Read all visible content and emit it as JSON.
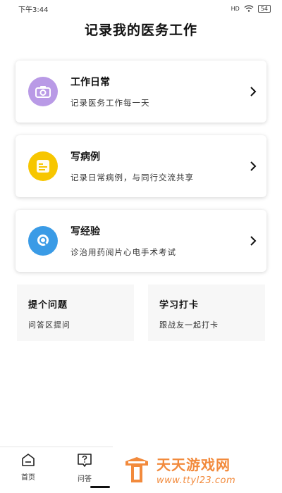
{
  "status_bar": {
    "time": "下午3:44",
    "signal": "HD",
    "battery": "54"
  },
  "page": {
    "title": "记录我的医务工作"
  },
  "cards": [
    {
      "title": "工作日常",
      "subtitle": "记录医务工作每一天",
      "icon": "camera-icon",
      "color": "#b99ae6"
    },
    {
      "title": "写病例",
      "subtitle": "记录日常病例，与同行交流共享",
      "icon": "document-icon",
      "color": "#f7c600"
    },
    {
      "title": "写经验",
      "subtitle": "诊治用药阅片心电手术考试",
      "icon": "chat-icon",
      "color": "#3a9be6"
    }
  ],
  "mini_cards": [
    {
      "title": "提个问题",
      "subtitle": "问答区提问"
    },
    {
      "title": "学习打卡",
      "subtitle": "跟战友一起打卡"
    }
  ],
  "tabs": [
    {
      "label": "首页",
      "icon": "home-icon"
    },
    {
      "label": "问答",
      "icon": "question-icon"
    }
  ],
  "watermark": {
    "name": "天天游戏网",
    "url": "www.ttyl23.com"
  }
}
